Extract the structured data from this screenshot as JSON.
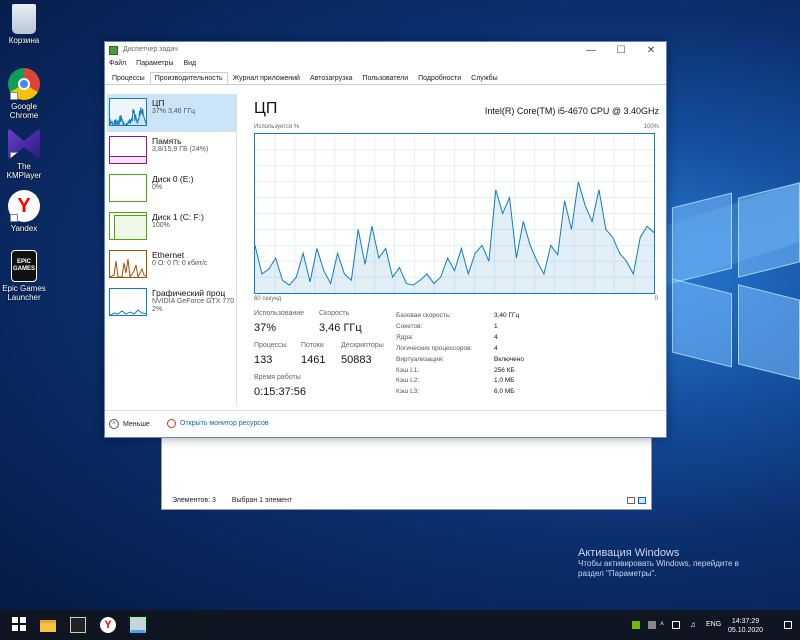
{
  "desktop_icons": [
    {
      "label": "Корзина",
      "icon": "recycle-bin-icon"
    },
    {
      "label": "Google Chrome",
      "icon": "chrome-icon"
    },
    {
      "label": "The KMPlayer",
      "icon": "kmplayer-icon"
    },
    {
      "label": "Yandex",
      "icon": "yandex-icon"
    },
    {
      "label": "Epic Games Launcher",
      "icon": "epic-games-icon",
      "badge": "EPIC GAMES"
    }
  ],
  "task_manager": {
    "title": "Диспетчер задач",
    "menu": [
      "Файл",
      "Параметры",
      "Вид"
    ],
    "tabs": [
      "Процессы",
      "Производительность",
      "Журнал приложений",
      "Автозагрузка",
      "Пользователи",
      "Подробности",
      "Службы"
    ],
    "active_tab": 1,
    "resources": [
      {
        "name": "ЦП",
        "sub1": "37% 3,46 ГГц",
        "sub2": "",
        "color": "#117dbb"
      },
      {
        "name": "Память",
        "sub1": "3,8/15,9 ГБ (24%)",
        "sub2": "",
        "color": "#8b12ae"
      },
      {
        "name": "Диск 0 (E:)",
        "sub1": "0%",
        "sub2": "",
        "color": "#4da60c"
      },
      {
        "name": "Диск 1 (C: F:)",
        "sub1": "100%",
        "sub2": "",
        "color": "#4da60c"
      },
      {
        "name": "Ethernet",
        "sub1": "0 О: 0 П: 0 кбит/с",
        "sub2": "",
        "color": "#a74f01"
      },
      {
        "name": "Графический проц",
        "sub1": "NVIDIA GeForce GTX 770",
        "sub2": "2%",
        "color": "#117dbb"
      }
    ],
    "cpu": {
      "title": "ЦП",
      "model": "Intel(R) Core(TM) i5-4670 CPU @ 3.40GHz",
      "graph_label": "Используется %",
      "graph_max": "100%",
      "graph_span": "60 секунд",
      "graph_min": "0",
      "usage_series": [
        30,
        12,
        15,
        22,
        8,
        5,
        10,
        25,
        7,
        28,
        14,
        6,
        25,
        12,
        8,
        40,
        18,
        42,
        22,
        28,
        10,
        16,
        6,
        5,
        8,
        12,
        6,
        10,
        22,
        14,
        28,
        12,
        25,
        30,
        20,
        65,
        50,
        60,
        22,
        45,
        30,
        20,
        12,
        30,
        24,
        58,
        40,
        70,
        55,
        45,
        65,
        40,
        35,
        25,
        20,
        12,
        35,
        42,
        38
      ],
      "stats": {
        "usage_label": "Использование",
        "usage_value": "37%",
        "speed_label": "Скорость",
        "speed_value": "3,46 ГГц",
        "processes_label": "Процессы",
        "processes_value": "133",
        "threads_label": "Потоки",
        "threads_value": "1461",
        "handles_label": "Дескрипторы",
        "handles_value": "50883",
        "uptime_label": "Время работы",
        "uptime_value": "0:15:37:56"
      },
      "details": [
        {
          "label": "Базовая скорость:",
          "value": "3,40 ГГц"
        },
        {
          "label": "Сокетов:",
          "value": "1"
        },
        {
          "label": "Ядра:",
          "value": "4"
        },
        {
          "label": "Логических процессоров:",
          "value": "4"
        },
        {
          "label": "Виртуализация:",
          "value": "Включено"
        },
        {
          "label": "Кэш L1:",
          "value": "256 КБ"
        },
        {
          "label": "Кэш L2:",
          "value": "1,0 МБ"
        },
        {
          "label": "Кэш L3:",
          "value": "6,0 МБ"
        }
      ]
    },
    "footer": {
      "less_label": "Меньше",
      "monitor_label": "Открыть монитор ресурсов"
    }
  },
  "explorer": {
    "status_items": "Элементов: 3",
    "status_selected": "Выбран 1 элемент"
  },
  "activation": {
    "title": "Активация Windows",
    "line1": "Чтобы активировать Windows, перейдите в",
    "line2": "раздел \"Параметры\"."
  },
  "taskbar": {
    "lang": "ENG",
    "time": "14:37:29",
    "date": "05.10.2020",
    "pinned": [
      "start-icon",
      "file-explorer-icon",
      "epic-games-icon",
      "yandex-icon",
      "task-manager-icon"
    ]
  }
}
